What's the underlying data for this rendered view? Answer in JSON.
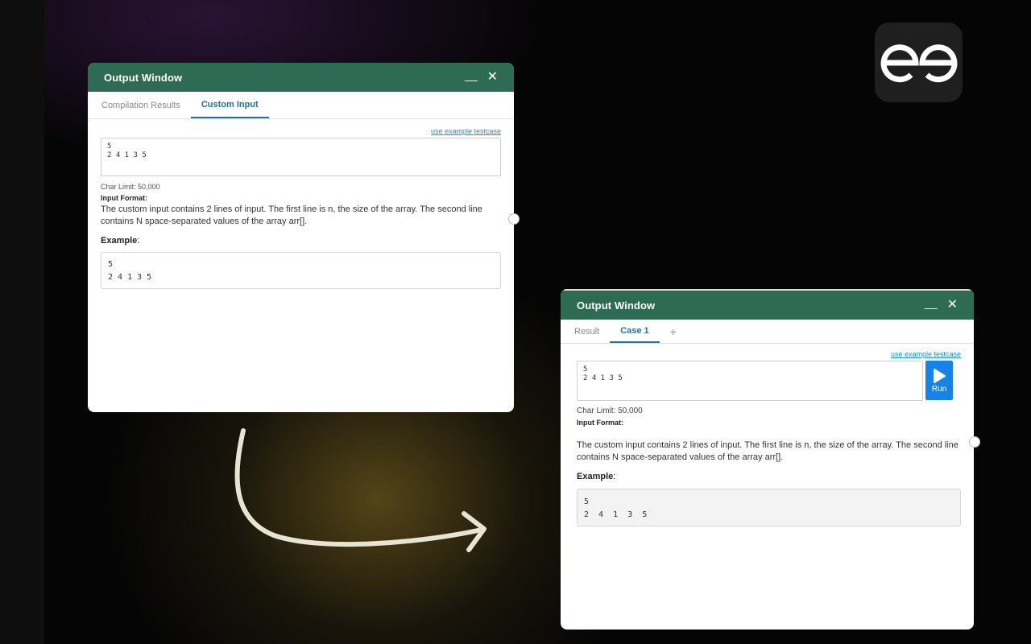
{
  "window_left": {
    "title": "Output Window",
    "minimize_label": "__",
    "close_label": "✕",
    "tabs": [
      {
        "label": "Compilation Results",
        "active": false
      },
      {
        "label": "Custom Input",
        "active": true
      }
    ],
    "example_link": "use example testcase",
    "input_value": "5\n2 4 1 3 5",
    "char_limit": "Char Limit: 50,000",
    "input_format_label": "Input Format:",
    "description": "The custom input contains 2 lines of input. The first line is n, the size of the array. The second line contains N space-separated values of the array arr[].",
    "example_label": "Example",
    "example_colon": ":",
    "example_value": "5\n2 4 1 3 5"
  },
  "window_right": {
    "title": "Output Window",
    "minimize_label": "__",
    "close_label": "✕",
    "tabs": [
      {
        "label": "Result",
        "active": false
      },
      {
        "label": "Case 1",
        "active": true
      },
      {
        "label": "+",
        "active": false
      }
    ],
    "example_link": "use example testcase",
    "input_value": "5\n2 4 1 3 5",
    "run_label": "Run",
    "char_limit": "Char Limit: 50,000",
    "input_format_label": "Input Format:",
    "description": "The custom input contains 2 lines of input. The first line is n, the size of the array. The second line contains N space-separated values of the array arr[].",
    "example_label": "Example",
    "example_colon": ":",
    "example_value": "5\n2  4  1  3  5"
  },
  "logo": {
    "icon": "gfg-logo-icon"
  },
  "colors": {
    "titlebar": "#2e6b55",
    "accent": "#1d6fbd",
    "run_button": "#1683e8",
    "arrow": "#e8e4d2"
  }
}
